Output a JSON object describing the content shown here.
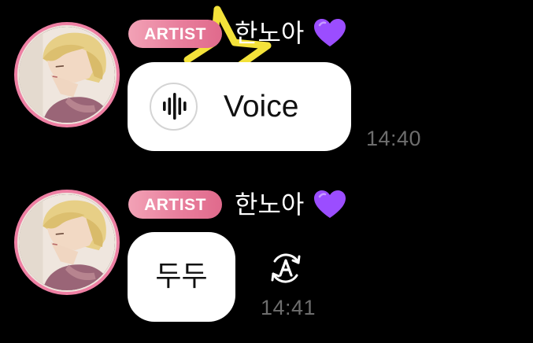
{
  "theme": {
    "background": "#000000",
    "badge_color": "#e87e9c",
    "avatar_ring_color": "#ee7fa3",
    "bubble_color": "#ffffff",
    "timestamp_color": "#6d6d6d",
    "heart_color": "#9b4dff"
  },
  "messages": [
    {
      "badge": "ARTIST",
      "sender": "한노아",
      "sender_emoji": "purple-heart-icon",
      "type": "voice",
      "icon": "voice-waveform-icon",
      "content": "Voice",
      "time": "14:40"
    },
    {
      "badge": "ARTIST",
      "sender": "한노아",
      "sender_emoji": "purple-heart-icon",
      "type": "text",
      "content": "두두",
      "translate_icon": "translate-icon",
      "time": "14:41"
    }
  ]
}
